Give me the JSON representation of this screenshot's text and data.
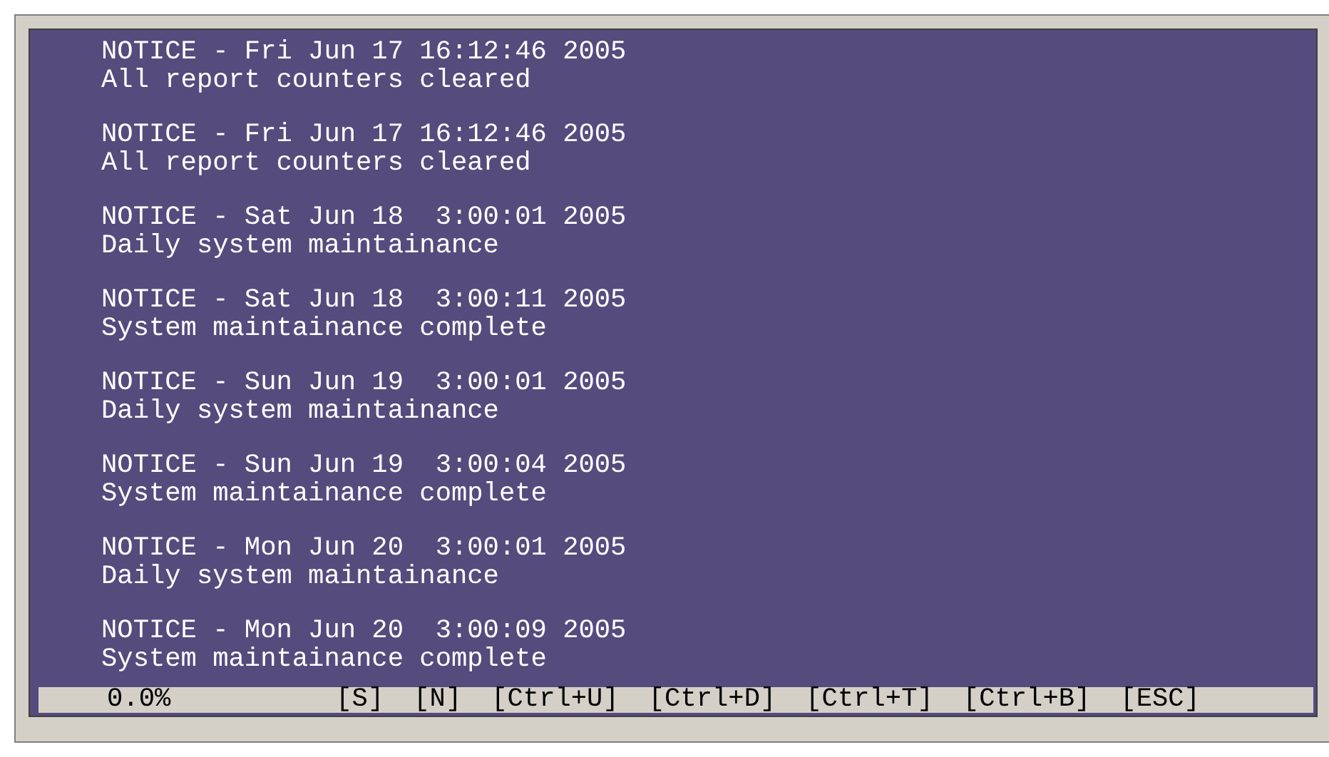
{
  "log_entries": [
    {
      "header": "NOTICE - Fri Jun 17 16:12:46 2005",
      "message": "All report counters cleared"
    },
    {
      "header": "NOTICE - Fri Jun 17 16:12:46 2005",
      "message": "All report counters cleared"
    },
    {
      "header": "NOTICE - Sat Jun 18  3:00:01 2005",
      "message": "Daily system maintainance"
    },
    {
      "header": "NOTICE - Sat Jun 18  3:00:11 2005",
      "message": "System maintainance complete"
    },
    {
      "header": "NOTICE - Sun Jun 19  3:00:01 2005",
      "message": "Daily system maintainance"
    },
    {
      "header": "NOTICE - Sun Jun 19  3:00:04 2005",
      "message": "System maintainance complete"
    },
    {
      "header": "NOTICE - Mon Jun 20  3:00:01 2005",
      "message": "Daily system maintainance"
    },
    {
      "header": "NOTICE - Mon Jun 20  3:00:09 2005",
      "message": "System maintainance complete"
    }
  ],
  "status_bar": {
    "progress": "0.0%",
    "keys": [
      "[S]",
      "[N]",
      "[Ctrl+U]",
      "[Ctrl+D]",
      "[Ctrl+T]",
      "[Ctrl+B]",
      "[ESC]"
    ]
  }
}
